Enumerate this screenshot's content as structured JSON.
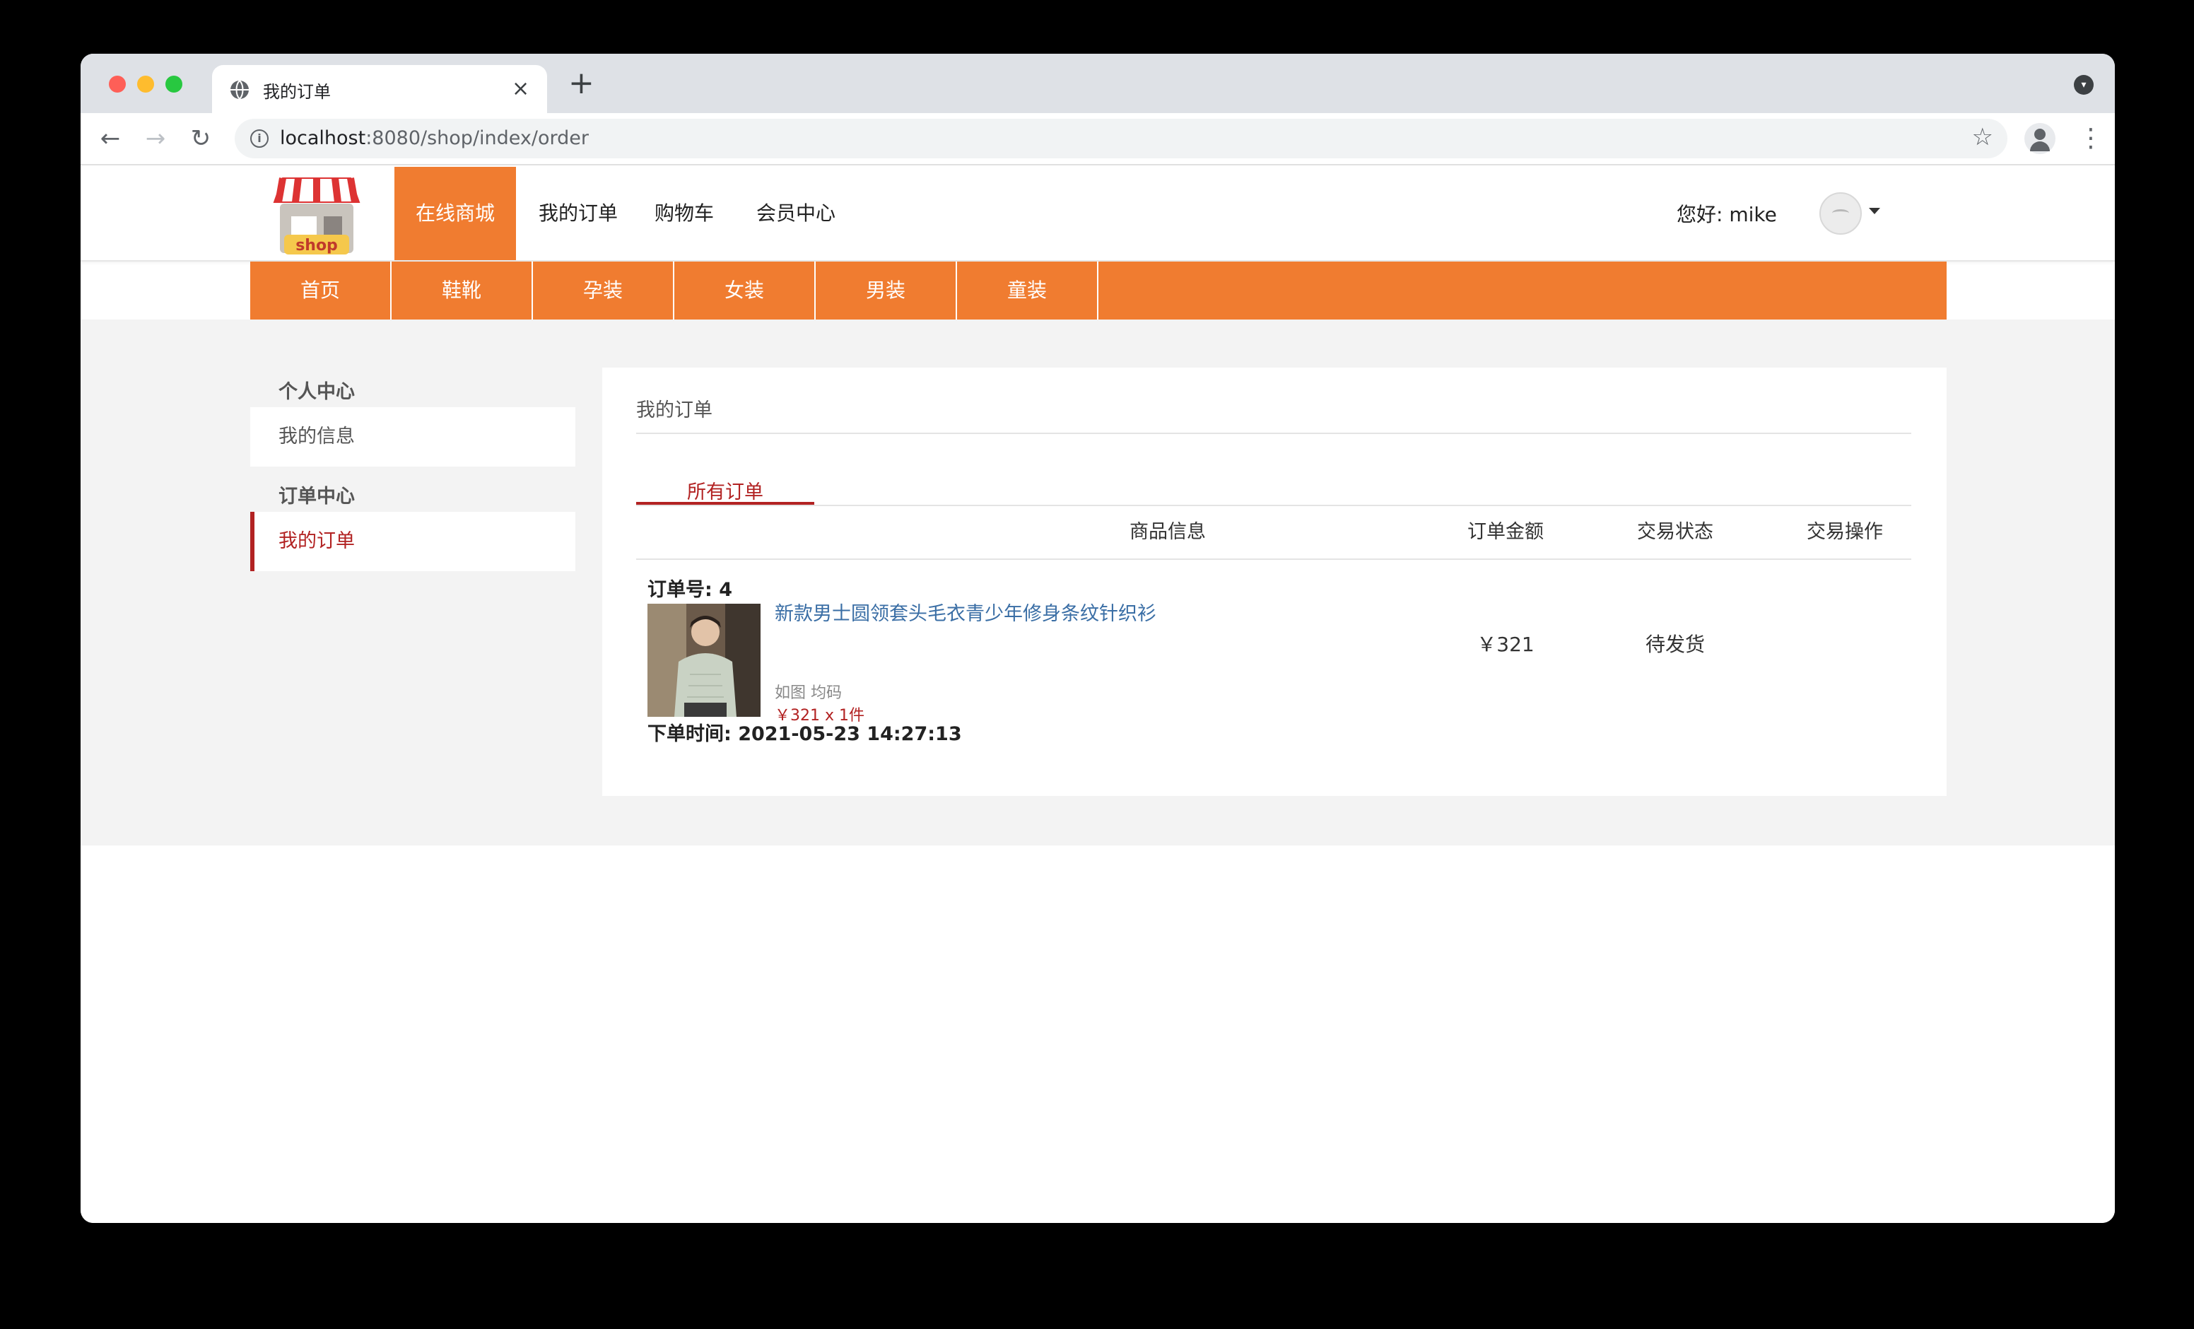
{
  "browser": {
    "tab_title": "我的订单",
    "url_host": "localhost",
    "url_rest": ":8080/shop/index/order"
  },
  "header": {
    "logo_text": "shop",
    "nav": [
      {
        "label": "在线商城",
        "active": true
      },
      {
        "label": "我的订单",
        "active": false
      },
      {
        "label": "购物车",
        "active": false
      },
      {
        "label": "会员中心",
        "active": false
      }
    ],
    "greeting": "您好:  mike"
  },
  "categories": [
    "首页",
    "鞋靴",
    "孕装",
    "女装",
    "男装",
    "童装"
  ],
  "sidebar": {
    "groups": [
      {
        "title": "个人中心",
        "items": [
          {
            "label": "我的信息",
            "active": false
          }
        ]
      },
      {
        "title": "订单中心",
        "items": [
          {
            "label": "我的订单",
            "active": true
          }
        ]
      }
    ]
  },
  "main": {
    "title": "我的订单",
    "tab": "所有订单",
    "columns": [
      "商品信息",
      "订单金额",
      "交易状态",
      "交易操作"
    ],
    "orders": [
      {
        "order_no": "订单号: 4",
        "product_name": "新款男士圆领套头毛衣青少年修身条纹针织衫",
        "spec": "如图 均码",
        "unit_price": "￥321 x 1件",
        "amount": "￥321",
        "status": "待发货",
        "action": "",
        "time": "下单时间: 2021-05-23 14:27:13"
      }
    ]
  },
  "colors": {
    "accent": "#f07c30",
    "active_red": "#b22222",
    "link_blue": "#3a6ea5"
  }
}
